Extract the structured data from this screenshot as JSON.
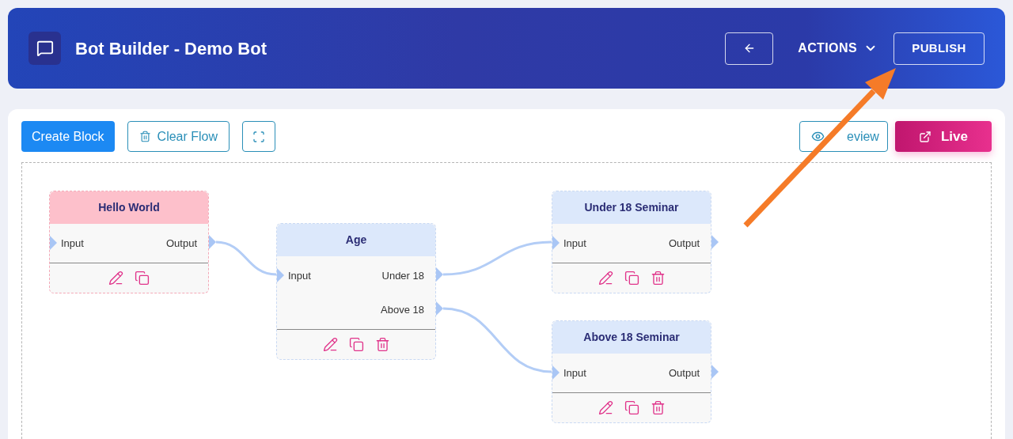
{
  "header": {
    "title": "Bot Builder - Demo Bot",
    "actions_label": "ACTIONS",
    "publish_label": "PUBLISH"
  },
  "toolbar": {
    "create_label": "Create Block",
    "clear_label": "Clear Flow",
    "preview_label": "eview",
    "live_label": "Live"
  },
  "nodes": [
    {
      "title": "Hello World",
      "kind": "start",
      "input": "Input",
      "outputs": [
        "Output"
      ],
      "actions": [
        {
          "kind": "edit"
        },
        {
          "kind": "copy"
        }
      ]
    },
    {
      "title": "Age",
      "kind": "step",
      "input": "Input",
      "outputs": [
        "Under 18",
        "Above 18"
      ],
      "actions": [
        {
          "kind": "edit"
        },
        {
          "kind": "copy"
        },
        {
          "kind": "delete"
        }
      ]
    },
    {
      "title": "Under 18 Seminar",
      "kind": "step",
      "input": "Input",
      "outputs": [
        "Output"
      ],
      "actions": [
        {
          "kind": "edit"
        },
        {
          "kind": "copy"
        },
        {
          "kind": "delete"
        }
      ]
    },
    {
      "title": "Above 18 Seminar",
      "kind": "step",
      "input": "Input",
      "outputs": [
        "Output"
      ],
      "actions": [
        {
          "kind": "edit"
        },
        {
          "kind": "copy"
        },
        {
          "kind": "delete"
        }
      ]
    }
  ]
}
